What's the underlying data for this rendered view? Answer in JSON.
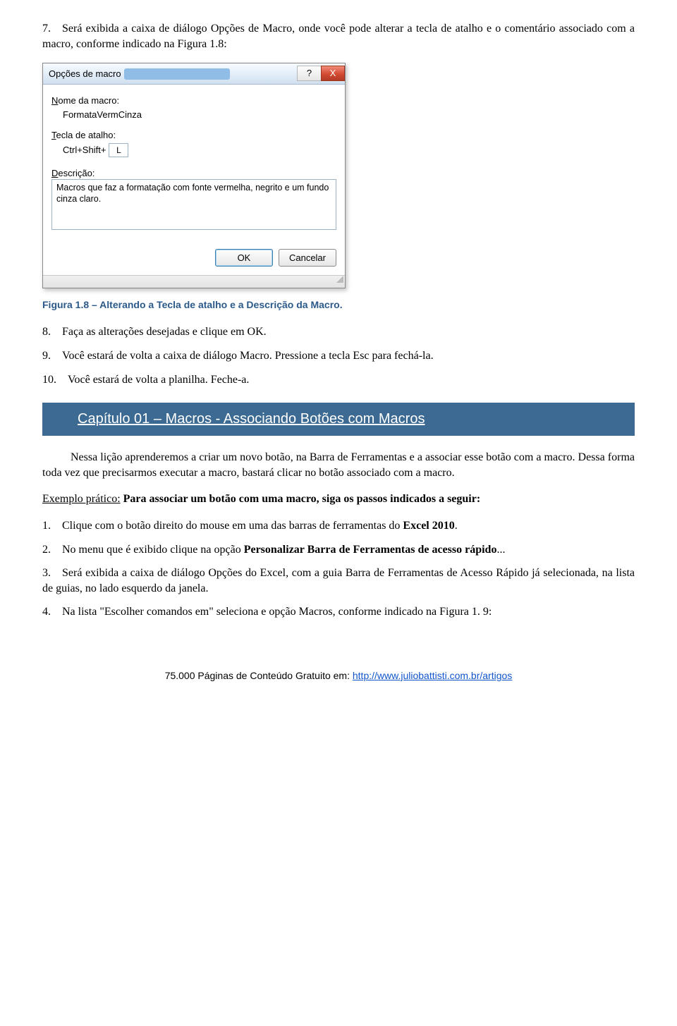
{
  "intro": {
    "item7": "7. Será exibida a caixa de diálogo Opções de Macro, onde você pode alterar a tecla de atalho e o comentário associado com a macro, conforme indicado na Figura 1.8:"
  },
  "dialog": {
    "title": "Opções de macro",
    "help_glyph": "?",
    "close_glyph": "X",
    "name_label_pre": "N",
    "name_label_post": "ome da macro:",
    "name_value": "FormataVermCinza",
    "shortcut_label_pre": "T",
    "shortcut_label_post": "ecla de atalho:",
    "shortcut_prefix": "Ctrl+Shift+",
    "shortcut_key": "L",
    "desc_label_pre": "D",
    "desc_label_post": "escrição:",
    "desc_value": "Macros que faz a formatação com fonte vermelha, negrito e um fundo cinza claro.",
    "ok": "OK",
    "cancel": "Cancelar"
  },
  "figcap": "Figura 1.8 – Alterando a Tecla de atalho e a Descrição da Macro.",
  "steps_a": {
    "s8": "8. Faça as alterações desejadas e clique em OK.",
    "s9": "9. Você estará de volta a caixa de diálogo Macro. Pressione a tecla Esc para fechá-la.",
    "s10": "10. Você estará de volta a planilha. Feche-a."
  },
  "section_title": "Capítulo 01 – Macros - Associando Botões com Macros",
  "body": {
    "p1": "Nessa lição aprenderemos a criar um novo botão, na Barra de Ferramentas e a associar esse botão com a macro. Dessa forma toda vez que precisarmos executar a macro, bastará clicar no botão associado com a macro.",
    "ex_label": "Exemplo prático:",
    "ex_rest": " Para associar um botão com uma macro, siga os passos indicados a seguir:"
  },
  "steps_b": {
    "s1_pre": "1. Clique com o botão direito do mouse em uma das barras de ferramentas do ",
    "s1_bold": "Excel 2010",
    "s1_post": ".",
    "s2_pre": "2. No menu que é exibido clique na opção ",
    "s2_bold": "Personalizar Barra de Ferramentas de acesso rápido",
    "s2_post": "...",
    "s3": "3. Será exibida a caixa de diálogo Opções do Excel, com a guia Barra de Ferramentas de Acesso Rápido já selecionada, na lista de guias, no lado esquerdo da janela.",
    "s4": "4. Na lista \"Escolher comandos em\" seleciona e opção Macros, conforme indicado na Figura 1. 9:"
  },
  "footer": {
    "pre": "75.000 Páginas de Conteúdo Gratuito em: ",
    "link": "http://www.juliobattisti.com.br/artigos"
  }
}
